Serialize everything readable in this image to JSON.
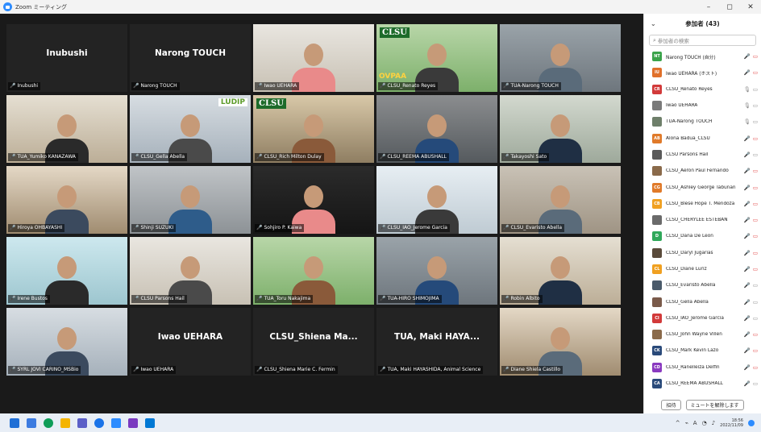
{
  "window": {
    "title": "Zoom ミーティング",
    "minimize": "–",
    "restore": "◻",
    "close": "✕"
  },
  "tiles": [
    {
      "big": "Inubushi",
      "label": "Inubushi"
    },
    {
      "big": "Narong TOUCH",
      "label": "Narong TOUCH"
    },
    {
      "label": "Iwao UEHARA"
    },
    {
      "label": "CLSU_Renato Reyes",
      "logo": "CLSU",
      "badge": "OVPAA"
    },
    {
      "label": "TUA-Narong TOUCH"
    },
    {
      "label": "TUA_Yumiko KANAZAWA"
    },
    {
      "label": "CLSU_Gella Abella",
      "badge": "LUDIP"
    },
    {
      "label": "CLSU_Rich Milton Dulay",
      "logo": "CLSU"
    },
    {
      "label": "CLSU_REEMA ABUSHALL"
    },
    {
      "label": "Takayoshi Sato"
    },
    {
      "label": "Hiroya OHBAYASHI"
    },
    {
      "label": "Shinji SUZUKI"
    },
    {
      "label": "Sohjiro P. Kaiwa"
    },
    {
      "label": "CLSU_IAO_Jerome Garcia"
    },
    {
      "label": "CLSU_Evaristo Abella"
    },
    {
      "label": "Irene Bustos"
    },
    {
      "label": "CLSU Parsons Hail"
    },
    {
      "label": "TUA_Toru Nakajima"
    },
    {
      "label": "TUA-HIRO SHIMOJIMA"
    },
    {
      "label": "Robin Albito"
    },
    {
      "label": "SYRL JOVI CARINO_MSBio"
    },
    {
      "big": "Iwao UEHARA",
      "label": "Iwao UEHARA"
    },
    {
      "big": "CLSU_Shiena  Ma...",
      "label": "CLSU_Shiena Marie C. Fermin"
    },
    {
      "big": "TUA, Maki HAYA...",
      "label": "TUA, Maki HAYASHIDA, Animal Science"
    },
    {
      "label": "Diane Shiela Castillo"
    }
  ],
  "panel": {
    "title": "参加者 (43)",
    "search_placeholder": "参加者の検索",
    "invite": "招待",
    "unmute_all": "ミュートを解除します",
    "participants": [
      {
        "initials": "NT",
        "name": "Narong TOUCH (自分)",
        "color": "#3aa34a",
        "mic": "off",
        "cam": "off"
      },
      {
        "initials": "IU",
        "name": "Iwao UEHARA (ホスト)",
        "color": "#e0702a",
        "mic": "off",
        "cam": "off"
      },
      {
        "initials": "CR",
        "name": "CLSU_Renato Reyes",
        "color": "#d23a3a",
        "mic": "on",
        "cam": "on"
      },
      {
        "initials": "",
        "name": "Iwao UEHARA",
        "color": "#7a7a7a",
        "mic": "on",
        "cam": "on"
      },
      {
        "initials": "",
        "name": "TUA-Narong TOUCH",
        "color": "#6e7f6a",
        "mic": "on",
        "cam": "on"
      },
      {
        "initials": "AB",
        "name": "Alona Badua_CLSU",
        "color": "#e07a2a",
        "mic": "off",
        "cam": "off"
      },
      {
        "initials": "",
        "name": "CLSU Parsons Hail",
        "color": "#5a5a5a",
        "mic": "off",
        "cam": "on"
      },
      {
        "initials": "",
        "name": "CLSU_Aeron Paul Fernando",
        "color": "#8a6a4a",
        "mic": "off",
        "cam": "off"
      },
      {
        "initials": "CG",
        "name": "CLSU_Ashley George Tabunan",
        "color": "#e07a2a",
        "mic": "off",
        "cam": "off"
      },
      {
        "initials": "CB",
        "name": "CLSU_Blese Hope T. Mendoza",
        "color": "#f0a020",
        "mic": "off",
        "cam": "off"
      },
      {
        "initials": "",
        "name": "CLSU_CHERYLEE ESTEBAN",
        "color": "#6a6a6a",
        "mic": "off",
        "cam": "off"
      },
      {
        "initials": "D",
        "name": "CLSU_Dana De Leon",
        "color": "#2fa85a",
        "mic": "off",
        "cam": "off"
      },
      {
        "initials": "",
        "name": "CLSU_Daryl Jugarias",
        "color": "#5a4a3a",
        "mic": "off",
        "cam": "off"
      },
      {
        "initials": "CL",
        "name": "CLSU_Diane Luriz",
        "color": "#f0a020",
        "mic": "off",
        "cam": "off"
      },
      {
        "initials": "",
        "name": "CLSU_Evaristo Abella",
        "color": "#4a5a6a",
        "mic": "off",
        "cam": "on"
      },
      {
        "initials": "",
        "name": "CLSU_Gella Abella",
        "color": "#7a5a4a",
        "mic": "off",
        "cam": "on"
      },
      {
        "initials": "CI",
        "name": "CLSU_IAO_Jerome Garcia",
        "color": "#d23a3a",
        "mic": "off",
        "cam": "on"
      },
      {
        "initials": "",
        "name": "CLSU_John Wayne Villen",
        "color": "#8a6a4a",
        "mic": "off",
        "cam": "off"
      },
      {
        "initials": "CK",
        "name": "CLSU_Mark Kevin Lazo",
        "color": "#2a4a7a",
        "mic": "off",
        "cam": "off"
      },
      {
        "initials": "CD",
        "name": "CLSU_Ranelleiza Delfin",
        "color": "#8a3ac0",
        "mic": "off",
        "cam": "off"
      },
      {
        "initials": "CA",
        "name": "CLSU_REEMA ABUSHALL",
        "color": "#2a4a7a",
        "mic": "off",
        "cam": "on"
      }
    ]
  },
  "taskbar": {
    "time": "18:56",
    "date": "2022/11/09",
    "lang": "A"
  }
}
